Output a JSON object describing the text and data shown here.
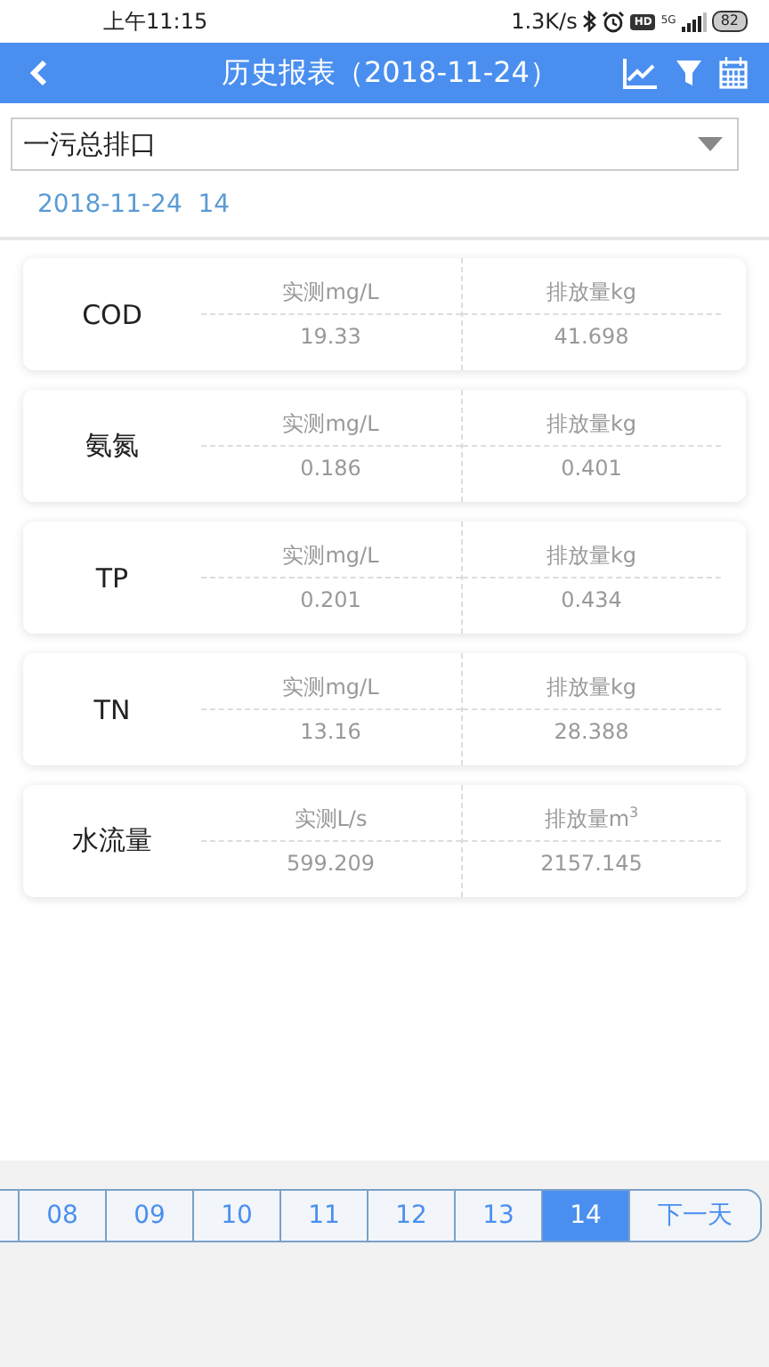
{
  "status_bar": {
    "time": "上午11:15",
    "speed": "1.3K/s",
    "hd": "HD",
    "network": "5G",
    "battery": "82"
  },
  "header": {
    "title": "历史报表（2018-11-24）"
  },
  "outlet_select": {
    "value": "一污总排口"
  },
  "date_label": "2018-11-24  14",
  "items": [
    {
      "name": "COD",
      "measured_label": "实测mg/L",
      "measured": "19.33",
      "emission_label": "排放量kg",
      "emission": "41.698"
    },
    {
      "name": "氨氮",
      "measured_label": "实测mg/L",
      "measured": "0.186",
      "emission_label": "排放量kg",
      "emission": "0.401"
    },
    {
      "name": "TP",
      "measured_label": "实测mg/L",
      "measured": "0.201",
      "emission_label": "排放量kg",
      "emission": "0.434"
    },
    {
      "name": "TN",
      "measured_label": "实测mg/L",
      "measured": "13.16",
      "emission_label": "排放量kg",
      "emission": "28.388"
    },
    {
      "name": "水流量",
      "measured_label": "实测L/s",
      "measured": "599.209",
      "emission_label": "排放量m$^{3}$",
      "emission": "2157.145"
    }
  ],
  "hours": [
    {
      "label": "08",
      "selected": false
    },
    {
      "label": "09",
      "selected": false
    },
    {
      "label": "10",
      "selected": false
    },
    {
      "label": "11",
      "selected": false
    },
    {
      "label": "12",
      "selected": false
    },
    {
      "label": "13",
      "selected": false
    },
    {
      "label": "14",
      "selected": true
    }
  ],
  "next_day": "下一天"
}
